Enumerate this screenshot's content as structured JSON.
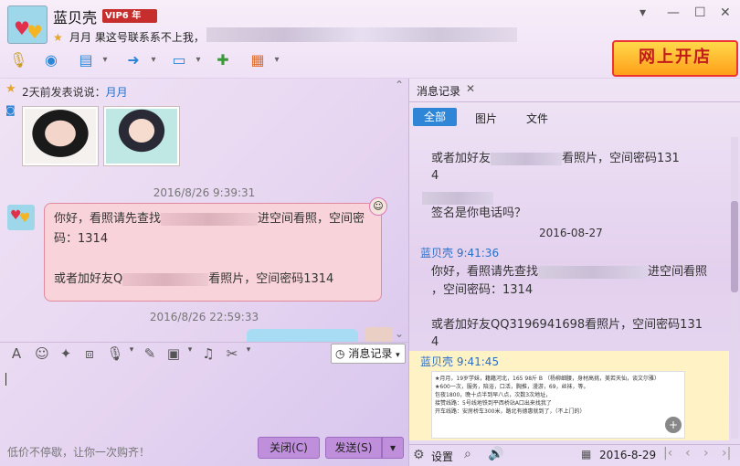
{
  "header": {
    "contact_name": "蓝贝壳",
    "vip_label": "VIP6 年",
    "signature": "月月 果这号联系系不上我，",
    "shop_banner": "网上开店"
  },
  "left": {
    "feed_prefix": "2天前发表说说：",
    "feed_link": "月月",
    "ts1": "2016/8/26 9:39:31",
    "bubble_line1_a": "你好，看照请先查找",
    "bubble_line1_b": "进空间看照，空间密",
    "bubble_line2": "码：1314",
    "bubble_line3_a": "或者加好友Q",
    "bubble_line3_b": "看照片，空间密码1314",
    "ts2": "2016/8/26 22:59:33",
    "msg_history_btn": "消息记录",
    "hint": "低价不停歇，让你一次购齐！",
    "close_btn": "关闭(C)",
    "send_btn": "发送(S)"
  },
  "right": {
    "panel_tab": "消息记录",
    "filter_all": "全部",
    "filter_pic": "图片",
    "filter_file": "文件",
    "r1a": "或者加好友",
    "r1b": "看照片，空间密码131",
    "r1c": "4",
    "r2": "签名是你电话吗？",
    "date": "2016-08-27",
    "sender1": "蓝贝壳  9:41:36",
    "r3a": "你好，看照请先查找",
    "r3b": "进空间看照",
    "r3c": "，空间密码：1314",
    "r4a": "或者加好友QQ3196941698看照片，空间密码131",
    "r4b": "4",
    "sender2": "蓝贝壳  9:41:45",
    "note1": "★月月，19岁学妹，籍籍河北，165 98斤 B （杨柳细腰，身材高挑，美若天仙，谈文尔雅）",
    "note2": "★600一次，服务，陪浴，口活，胸推，漫游，69，丝袜，等。",
    "note3": "包夜1800，晚十点半到早八点，次数3次地址，",
    "note4": "接赞线路：5号线地铁到平西桥站A口出来找我了",
    "note5": "开车线路：安房桥车300米，路北有德惠就到了，（不上门的）",
    "settings": "设置",
    "footer_date": "2016-8-29"
  }
}
